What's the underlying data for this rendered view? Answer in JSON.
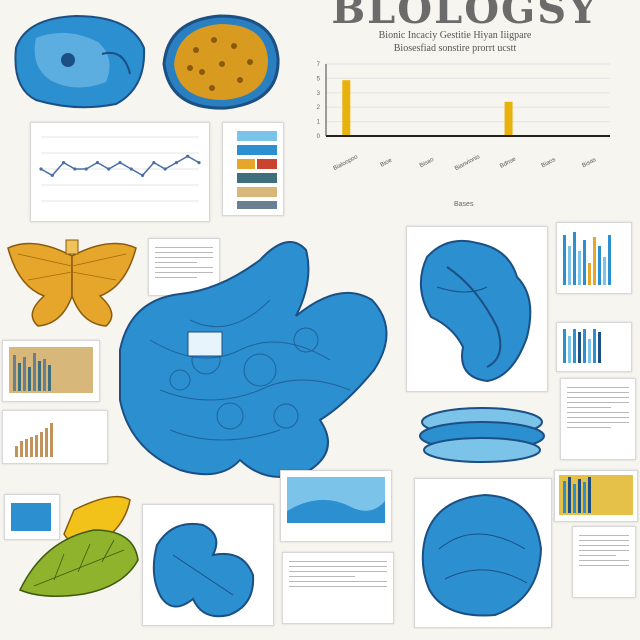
{
  "poster": {
    "title": "BLOLOGSY",
    "subtitle_line1": "Bionic Incaciy  Gestitie  Hiyan  Iiigpare",
    "subtitle_line2": "Biosesfiad sonstire prorrt ucstt",
    "chart_caption": "Bases"
  },
  "chart_data": [
    {
      "type": "bar",
      "title": "",
      "ylim": [
        0,
        8
      ],
      "y_ticks": [
        "7",
        "5",
        "3",
        "2",
        "1",
        "0"
      ],
      "categories": [
        "Bialoopoo",
        "Bioe",
        "Bisao",
        "Bianvionis",
        "Bdnse",
        "Biaos",
        "Bisas"
      ],
      "values": [
        6.2,
        0,
        0,
        0,
        3.8,
        0,
        0
      ],
      "colors": {
        "bar": "#e8b10c",
        "axis": "#222222",
        "grid": "#e3e3e3"
      }
    },
    {
      "type": "line",
      "title": "",
      "values": [
        5,
        4,
        6,
        5,
        5,
        6,
        5,
        6,
        5,
        4,
        6,
        5,
        6,
        7,
        6
      ],
      "colors": {
        "line": "#4a6fa5",
        "grid": "#dedede"
      }
    }
  ],
  "colors": {
    "cell_blue": "#2b8fd0",
    "cell_blue_light": "#7cc3ea",
    "cell_outline": "#1c4f84",
    "amber": "#e6a52b",
    "olive": "#8fb32c",
    "yellow": "#f2c21b"
  }
}
